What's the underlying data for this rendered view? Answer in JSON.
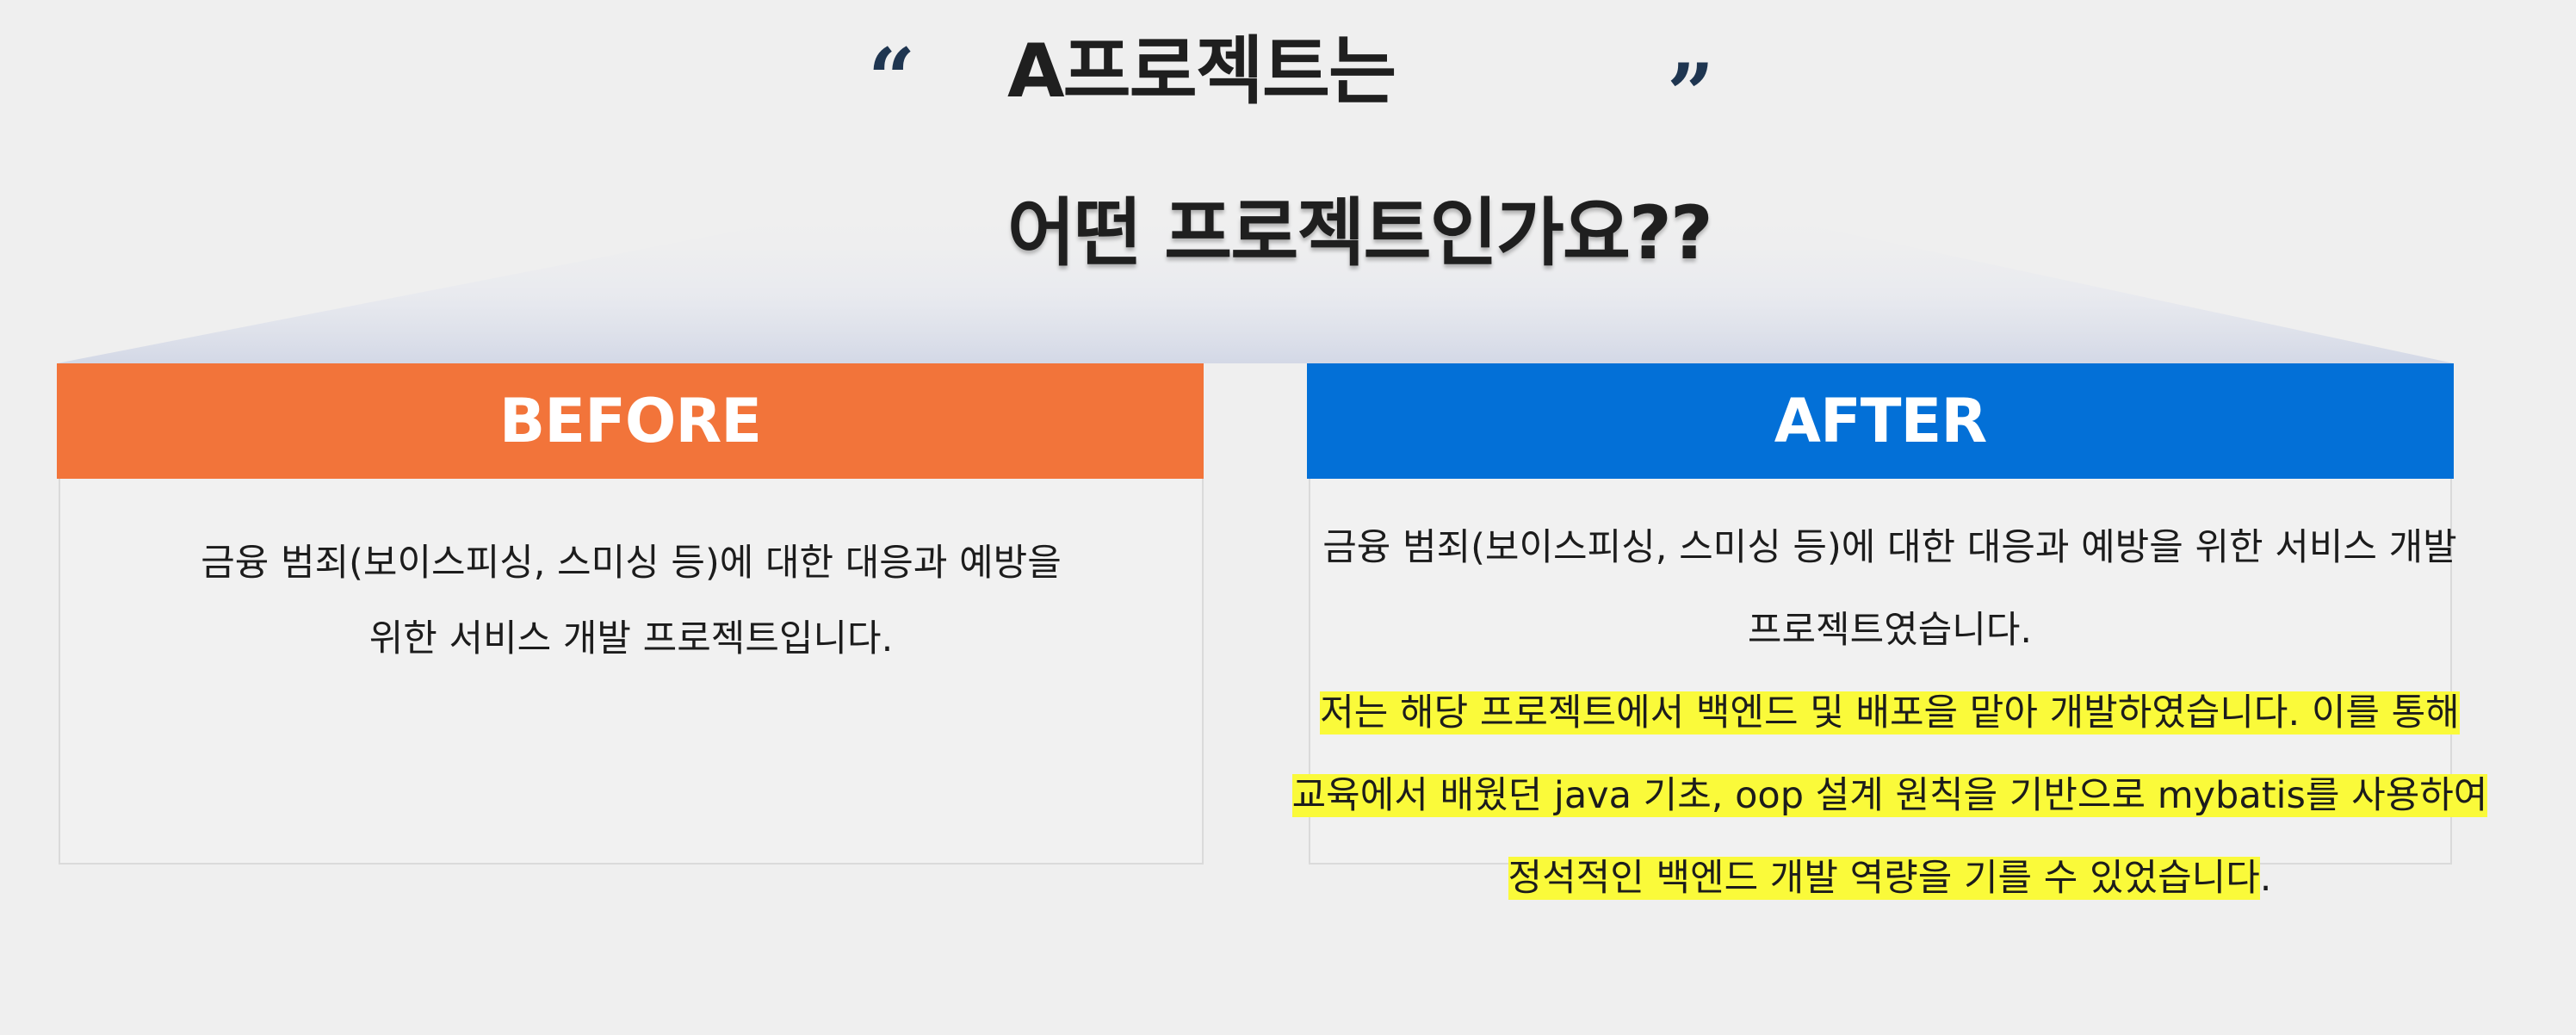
{
  "slide": {
    "quote_open": "“",
    "quote_close": "”",
    "title_line_1": "A프로젝트는",
    "title_line_2": "어떤 프로젝트인가요??"
  },
  "before": {
    "label": "BEFORE",
    "line_1": "금융 범죄(보이스피싱, 스미싱 등)에 대한 대응과 예방을",
    "line_2": "위한 서비스 개발 프로젝트입니다.",
    "accent_color": "#f2743a"
  },
  "after": {
    "label": "AFTER",
    "line_1": "금융 범죄(보이스피싱, 스미싱 등)에 대한 대응과 예방을 위한 서비스 개발",
    "line_2": "프로젝트였습니다.",
    "highlight_1": "저는 해당 프로젝트에서 백엔드 및 배포을 맡아 개발하였습니다. 이를 통해",
    "highlight_2": "교육에서 배웠던 java 기초, oop 설계 원칙을 기반으로 mybatis를 사용하여",
    "highlight_3": "정석적인 백엔드 개발 역량을 기를 수 있었습니다",
    "trailing": ".",
    "accent_color": "#0370d7",
    "highlight_color": "#fafa3a"
  }
}
